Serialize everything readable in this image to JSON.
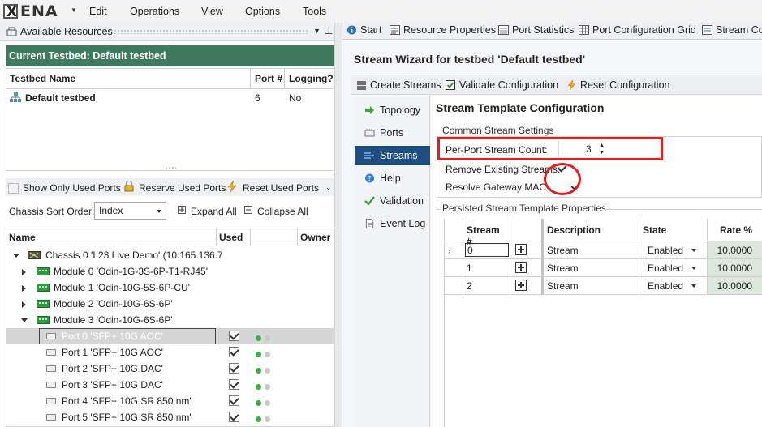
{
  "app": {
    "logo_text": "ENA",
    "logo_letter": "X",
    "menu": [
      "Edit",
      "Operations",
      "View",
      "Options",
      "Tools"
    ]
  },
  "resources": {
    "title": "Available Resources",
    "testbed_header": "Current Testbed: Default testbed",
    "testbed_columns": [
      "Testbed Name",
      "Port #",
      "Logging?"
    ],
    "testbed_rows": [
      {
        "name": "Default testbed",
        "ports": "6",
        "logging": "No"
      }
    ],
    "show_only_used_label": "Show Only Used Ports",
    "reserve_used_label": "Reserve Used Ports",
    "reset_used_label": "Reset Used Ports",
    "chassis_sort_label": "Chassis Sort Order:",
    "chassis_sort_value": "Index",
    "expand_all": "Expand All",
    "collapse_all": "Collapse All",
    "tree_columns": [
      "Name",
      "Used",
      "Owner"
    ],
    "chassis": "Chassis 0 'L23 Live Demo' (10.165.136.7",
    "modules": [
      "Module 0 'Odin-1G-3S-6P-T1-RJ45'",
      "Module 1 'Odin-10G-5S-6P-CU'",
      "Module 2 'Odin-10G-6S-6P'",
      "Module 3 'Odin-10G-6S-6P'"
    ],
    "ports": [
      "Port 0 'SFP+ 10G AOC'",
      "Port 1 'SFP+ 10G AOC'",
      "Port 2 'SFP+ 10G DAC'",
      "Port 3 'SFP+ 10G DAC'",
      "Port 4 'SFP+ 10G SR 850 nm'",
      "Port 5 'SFP+ 10G SR 850 nm'"
    ]
  },
  "tabs": [
    "Start",
    "Resource Properties",
    "Port Statistics",
    "Port Configuration Grid",
    "Stream Co"
  ],
  "wizard": {
    "title": "Stream Wizard for testbed 'Default testbed'",
    "toolbar": {
      "create": "Create Streams",
      "validate": "Validate Configuration",
      "reset": "Reset Configuration"
    },
    "nav": [
      "Topology",
      "Ports",
      "Streams",
      "Help",
      "Validation",
      "Event Log"
    ],
    "active_nav": "Streams",
    "section_title": "Stream Template Configuration",
    "common_group": "Common Stream Settings",
    "per_port_label": "Per-Port Stream Count:",
    "per_port_value": "3",
    "remove_existing_label": "Remove Existing Streams:",
    "resolve_gateway_label": "Resolve Gateway MAC:",
    "persisted_group": "Persisted Stream Template Properties",
    "grid_columns": [
      "Stream #",
      "Description",
      "State",
      "Rate %"
    ],
    "grid_rows": [
      {
        "stream": "0",
        "description": "Stream",
        "state": "Enabled",
        "rate": "10.0000"
      },
      {
        "stream": "1",
        "description": "Stream",
        "state": "Enabled",
        "rate": "10.0000"
      },
      {
        "stream": "2",
        "description": "Stream",
        "state": "Enabled",
        "rate": "10.0000"
      }
    ]
  },
  "colors": {
    "testbed_header_bg": "#3f7a5e",
    "nav_active_bg": "#1f4f7f",
    "highlight_red": "#e02020",
    "rate_cell_bg": "#dde8dd"
  }
}
